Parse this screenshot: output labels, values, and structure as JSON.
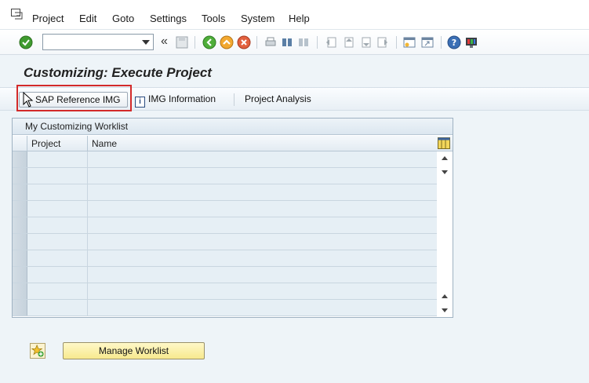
{
  "menu": [
    "Project",
    "Edit",
    "Goto",
    "Settings",
    "Tools",
    "System",
    "Help"
  ],
  "toolbar": {
    "command_value": "",
    "back_glyph": "«"
  },
  "page": {
    "title": "Customizing: Execute Project"
  },
  "app_toolbar": {
    "sap_reference_img": "SAP Reference IMG",
    "img_information": "IMG Information",
    "project_analysis": "Project Analysis"
  },
  "worklist": {
    "title": "My Customizing Worklist",
    "columns": [
      "Project",
      "Name"
    ],
    "rows": [
      {
        "project": "",
        "name": ""
      },
      {
        "project": "",
        "name": ""
      },
      {
        "project": "",
        "name": ""
      },
      {
        "project": "",
        "name": ""
      },
      {
        "project": "",
        "name": ""
      },
      {
        "project": "",
        "name": ""
      },
      {
        "project": "",
        "name": ""
      },
      {
        "project": "",
        "name": ""
      },
      {
        "project": "",
        "name": ""
      },
      {
        "project": "",
        "name": ""
      }
    ]
  },
  "bottom": {
    "manage_worklist": "Manage Worklist"
  },
  "colors": {
    "highlight": "#d32a2a",
    "accent_yellow": "#f7e98e",
    "bg": "#eef4f8"
  }
}
